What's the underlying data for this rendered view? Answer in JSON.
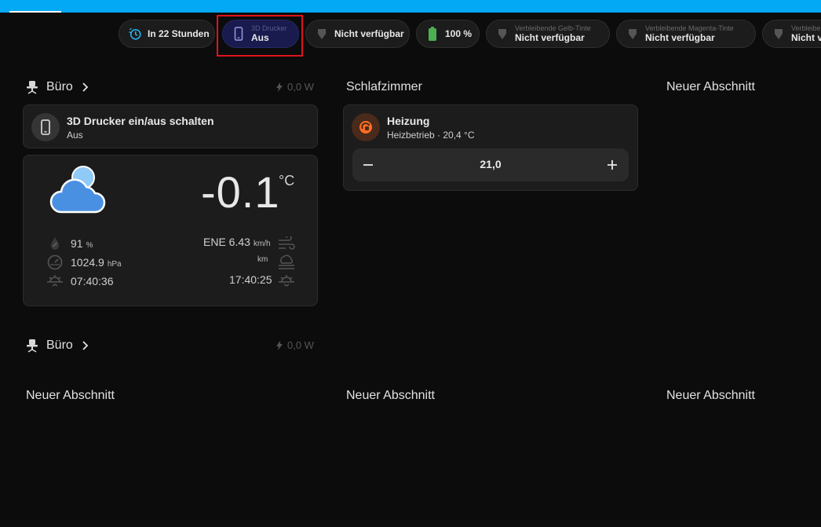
{
  "colors": {
    "accent": "#03a9f4",
    "battery": "#4caf50",
    "heating": "#ff6f22",
    "highlight": "#e0141c"
  },
  "badges": [
    {
      "icon": "timer-sync-icon",
      "sub": "",
      "main": "In 22 Stunden"
    },
    {
      "icon": "cellphone-icon",
      "sub": "3D Drucker",
      "main": "Aus"
    },
    {
      "icon": "water-drop-icon",
      "sub": "",
      "main": "Nicht verfügbar"
    },
    {
      "icon": "battery-icon",
      "sub": "",
      "main": "100 %"
    },
    {
      "icon": "water-drop-icon",
      "sub": "Verbleibende Gelb-Tinte",
      "main": "Nicht verfügbar"
    },
    {
      "icon": "water-drop-icon",
      "sub": "Verbleibende Magenta-Tinte",
      "main": "Nicht verfügbar"
    },
    {
      "icon": "water-drop-icon",
      "sub": "Verbleibe",
      "main": "Nicht ve"
    }
  ],
  "sections": {
    "buero1": {
      "title": "Büro",
      "power": "0,0 W"
    },
    "schlafzimmer": {
      "title": "Schlafzimmer"
    },
    "neuer1": {
      "title": "Neuer Abschnitt"
    },
    "buero2": {
      "title": "Büro",
      "power": "0,0 W"
    },
    "neuer2": {
      "title": "Neuer Abschnitt"
    },
    "neuer3": {
      "title": "Neuer Abschnitt"
    },
    "neuer4": {
      "title": "Neuer Abschnitt"
    }
  },
  "printer_tile": {
    "title": "3D Drucker ein/aus schalten",
    "state": "Aus"
  },
  "heating_tile": {
    "title": "Heizung",
    "state": "Heizbetrieb · 20,4 °C",
    "target": "21,0"
  },
  "weather": {
    "temperature": "-0.1",
    "unit": "°C",
    "humidity": "91",
    "humidity_unit": "%",
    "pressure": "1024.9",
    "pressure_unit": "hPa",
    "sunrise": "07:40:36",
    "wind": "ENE 6.43",
    "wind_unit": "km/h",
    "visibility_unit": "km",
    "sunset": "17:40:25"
  }
}
